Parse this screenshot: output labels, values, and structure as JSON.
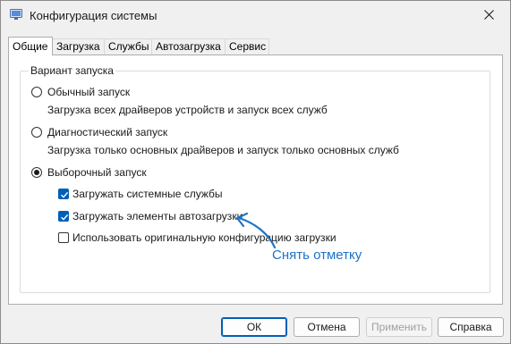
{
  "window": {
    "title": "Конфигурация системы"
  },
  "tabs": [
    {
      "label": "Общие",
      "active": true
    },
    {
      "label": "Загрузка",
      "active": false
    },
    {
      "label": "Службы",
      "active": false
    },
    {
      "label": "Автозагрузка",
      "active": false
    },
    {
      "label": "Сервис",
      "active": false
    }
  ],
  "startup": {
    "group_label": "Вариант запуска",
    "options": [
      {
        "label": "Обычный запуск",
        "description": "Загрузка всех драйверов устройств и запуск всех служб",
        "selected": false
      },
      {
        "label": "Диагностический запуск",
        "description": "Загрузка только основных драйверов и запуск только основных служб",
        "selected": false
      },
      {
        "label": "Выборочный запуск",
        "selected": true
      }
    ],
    "selective_items": [
      {
        "label": "Загружать системные службы",
        "checked": true
      },
      {
        "label": "Загружать элементы автозагрузки",
        "checked": true
      },
      {
        "label": "Использовать оригинальную конфигурацию загрузки",
        "checked": false
      }
    ]
  },
  "annotation": {
    "text": "Снять отметку",
    "color": "#1e72c8"
  },
  "buttons": {
    "ok": "ОК",
    "cancel": "Отмена",
    "apply": "Применить",
    "help": "Справка"
  },
  "colors": {
    "accent": "#005fb8"
  }
}
